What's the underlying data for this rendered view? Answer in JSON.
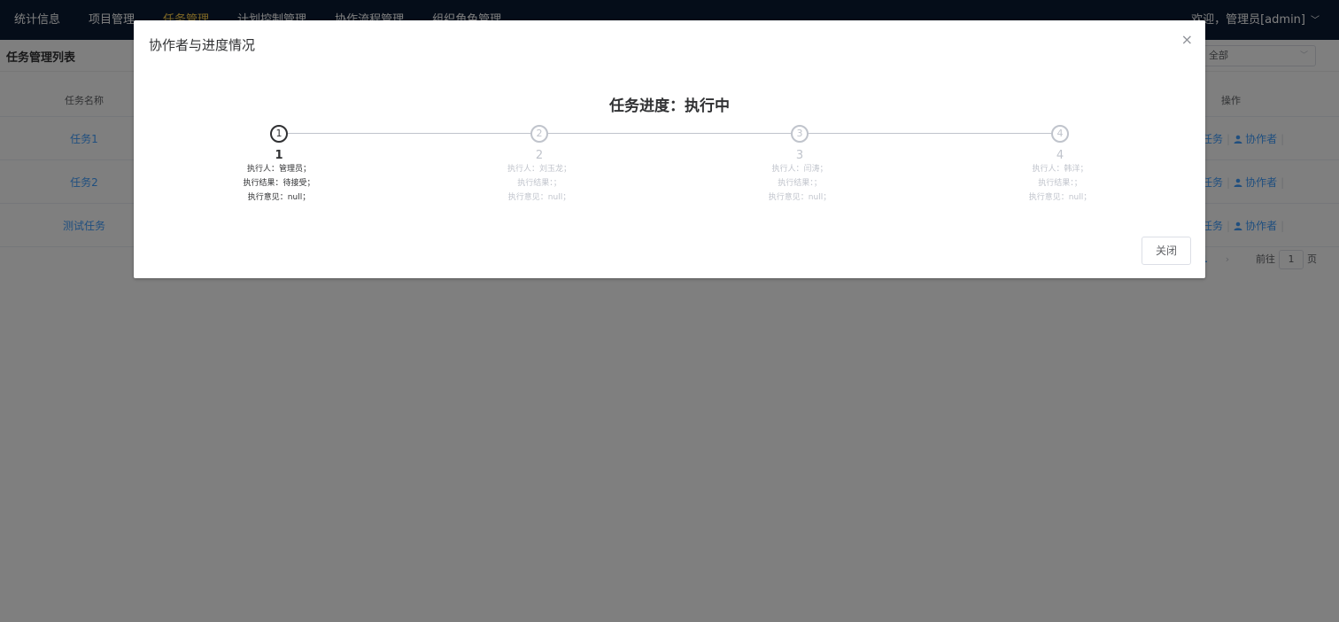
{
  "nav": {
    "items": [
      "统计信息",
      "项目管理",
      "任务管理",
      "计划控制管理",
      "协作流程管理",
      "组织角色管理"
    ],
    "active_index": 2,
    "user": "欢迎，管理员[admin]"
  },
  "page": {
    "title": "任务管理列表",
    "filter_value": "全部"
  },
  "table": {
    "headers": {
      "name": "任务名称",
      "operation": "操作"
    },
    "rows": [
      {
        "name": "任务1",
        "op_task": "任务",
        "op_collab": "协作者"
      },
      {
        "name": "任务2",
        "op_task": "任务",
        "op_collab": "协作者"
      },
      {
        "name": "测试任务",
        "op_task": "任务",
        "op_collab": "协作者"
      }
    ]
  },
  "pagination": {
    "current_page": "1",
    "goto_label": "前往",
    "goto_value": "1",
    "page_suffix": "页"
  },
  "dialog": {
    "title": "协作者与进度情况",
    "progress_title": "任务进度：执行中",
    "current_step": 1,
    "steps": [
      {
        "number": "1",
        "title": "1",
        "executor": "执行人：管理员；",
        "result": "执行结果：待接受；",
        "opinion": "执行意见：null；"
      },
      {
        "number": "2",
        "title": "2",
        "executor": "执行人：刘玉龙；",
        "result": "执行结果：；",
        "opinion": "执行意见：null；"
      },
      {
        "number": "3",
        "title": "3",
        "executor": "执行人：闫涛；",
        "result": "执行结果：；",
        "opinion": "执行意见：null；"
      },
      {
        "number": "4",
        "title": "4",
        "executor": "执行人：韩洋；",
        "result": "执行结果：；",
        "opinion": "执行意见：null；"
      }
    ],
    "close_label": "关闭"
  },
  "colors": {
    "nav_bg": "#0b1a33",
    "nav_active": "#ffd04b",
    "link": "#409eff",
    "step_inactive": "#c0c4cc",
    "step_active": "#303133"
  },
  "icons": {
    "close": "close-icon",
    "person": "user-icon",
    "dropdown": "chevron-down-icon"
  }
}
